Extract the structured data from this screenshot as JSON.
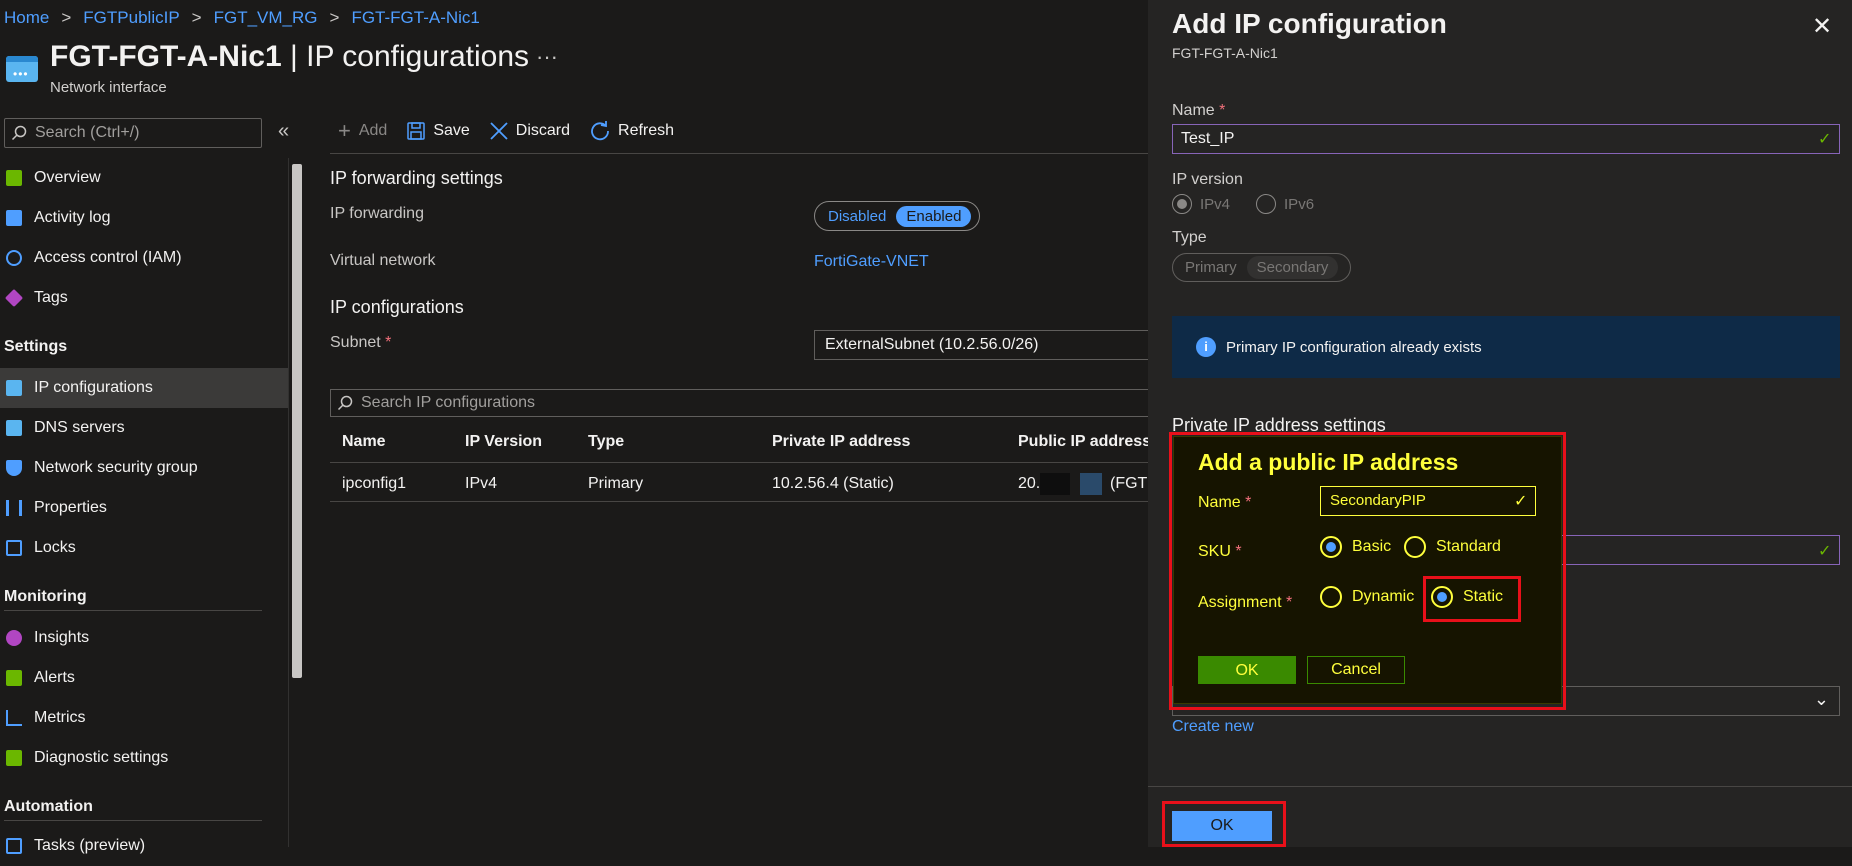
{
  "breadcrumb": [
    "Home",
    "FGTPublicIP",
    "FGT_VM_RG",
    "FGT-FGT-A-Nic1"
  ],
  "header": {
    "title_bold": "FGT-FGT-A-Nic1",
    "title_rest": " | IP configurations",
    "more": "···",
    "subtitle": "Network interface",
    "icon": "network-interface-icon"
  },
  "nav": {
    "search_placeholder": "Search (Ctrl+/)",
    "collapse": "«",
    "items": [
      {
        "label": "Overview",
        "icon": "overview-icon",
        "color": "#6bb700"
      },
      {
        "label": "Activity log",
        "icon": "activity-log-icon",
        "color": "#4f9eff"
      },
      {
        "label": "Access control (IAM)",
        "icon": "iam-icon",
        "color": "#4f9eff"
      },
      {
        "label": "Tags",
        "icon": "tag-icon",
        "color": "#b146c2"
      },
      {
        "label": "IP configurations",
        "icon": "ip-config-icon",
        "color": "#5ab5f0"
      },
      {
        "label": "DNS servers",
        "icon": "dns-icon",
        "color": "#5ab5f0"
      },
      {
        "label": "Network security group",
        "icon": "shield-icon",
        "color": "#4f9eff"
      },
      {
        "label": "Properties",
        "icon": "properties-icon",
        "color": "#4f9eff"
      },
      {
        "label": "Locks",
        "icon": "lock-icon",
        "color": "#4f9eff"
      },
      {
        "label": "Insights",
        "icon": "lightbulb-icon",
        "color": "#b146c2"
      },
      {
        "label": "Alerts",
        "icon": "alert-icon",
        "color": "#6bb700"
      },
      {
        "label": "Metrics",
        "icon": "metrics-icon",
        "color": "#4f9eff"
      },
      {
        "label": "Diagnostic settings",
        "icon": "diagnostic-icon",
        "color": "#6bb700"
      },
      {
        "label": "Tasks (preview)",
        "icon": "tasks-icon",
        "color": "#4f9eff"
      }
    ],
    "sections": [
      "Settings",
      "Monitoring",
      "Automation"
    ]
  },
  "toolbar": {
    "add": "Add",
    "save": "Save",
    "discard": "Discard",
    "refresh": "Refresh"
  },
  "main": {
    "fwd_heading": "IP forwarding settings",
    "fwd_label": "IP forwarding",
    "fwd_options": [
      "Disabled",
      "Enabled"
    ],
    "fwd_selected": "Enabled",
    "vnet_label": "Virtual network",
    "vnet_value": "FortiGate-VNET",
    "ipcfg_heading": "IP configurations",
    "subnet_label": "Subnet",
    "subnet_value": "ExternalSubnet (10.2.56.0/26)",
    "search_placeholder": "Search IP configurations",
    "columns": [
      "Name",
      "IP Version",
      "Type",
      "Private IP address",
      "Public IP address"
    ],
    "rows": [
      {
        "name": "ipconfig1",
        "version": "IPv4",
        "type": "Primary",
        "private_ip": "10.2.56.4 (Static)",
        "public_ip_prefix": "20.",
        "public_ip_suffix": "(FGTP"
      }
    ]
  },
  "panel": {
    "title": "Add IP configuration",
    "subtitle": "FGT-FGT-A-Nic1",
    "name_label": "Name",
    "name_value": "Test_IP",
    "version_label": "IP version",
    "versions": [
      "IPv4",
      "IPv6"
    ],
    "version_selected": "IPv4",
    "type_label": "Type",
    "types": [
      "Primary",
      "Secondary"
    ],
    "type_selected": "Secondary",
    "info_text": "Primary IP configuration already exists",
    "private_heading": "Private IP address settings",
    "create_new": "Create new",
    "ok": "OK",
    "close": "✕"
  },
  "popup": {
    "title": "Add a public IP address",
    "name_label": "Name",
    "name_value": "SecondaryPIP",
    "sku_label": "SKU",
    "sku_options": [
      "Basic",
      "Standard"
    ],
    "sku_selected": "Basic",
    "assignment_label": "Assignment",
    "assignment_options": [
      "Dynamic",
      "Static"
    ],
    "assignment_selected": "Static",
    "ok": "OK",
    "cancel": "Cancel"
  },
  "colors": {
    "accent": "#4f9eff",
    "highlight": "#e8101a",
    "popup_text": "#ffff3c",
    "popup_ok": "#3a8a00"
  }
}
